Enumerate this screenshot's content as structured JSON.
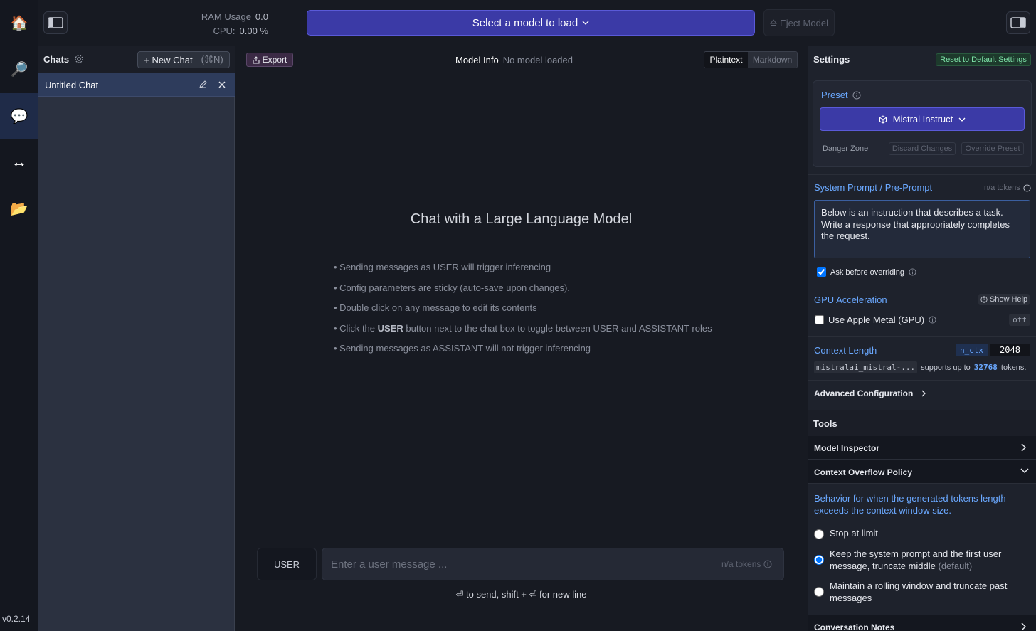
{
  "rail": {
    "items": [
      {
        "name": "home",
        "glyph": "🏠"
      },
      {
        "name": "search",
        "glyph": "🔎"
      },
      {
        "name": "chat",
        "glyph": "💬"
      },
      {
        "name": "server",
        "glyph": "↔"
      },
      {
        "name": "folder",
        "glyph": "📂"
      }
    ],
    "version": "v0.2.14"
  },
  "topbar": {
    "ram_label": "RAM Usage",
    "ram_value": "0.0",
    "cpu_label": "CPU:",
    "cpu_value": "0.00 %",
    "load_model_label": "Select a model to load",
    "eject_label": "Eject Model"
  },
  "chats": {
    "title": "Chats",
    "new_chat_label": "+ New Chat",
    "new_chat_shortcut": "(⌘N)",
    "items": [
      {
        "name": "Untitled Chat"
      }
    ]
  },
  "main": {
    "export_label": "Export",
    "model_info_label": "Model Info",
    "model_info_value": "No model loaded",
    "format_tabs": [
      "Plaintext",
      "Markdown"
    ],
    "hero_title": "Chat with a Large Language Model",
    "tips": [
      {
        "pre": "Sending messages as USER will trigger inferencing",
        "bold": "",
        "post": ""
      },
      {
        "pre": "Config parameters are sticky (auto-save upon changes).",
        "bold": "",
        "post": ""
      },
      {
        "pre": "Double click on any message to edit its contents",
        "bold": "",
        "post": ""
      },
      {
        "pre": "Click the ",
        "bold": "USER",
        "post": " button next to the chat box to toggle between USER and ASSISTANT roles"
      },
      {
        "pre": "Sending messages as ASSISTANT will not trigger inferencing",
        "bold": "",
        "post": ""
      }
    ],
    "role_label": "USER",
    "input_placeholder": "Enter a user message ...",
    "input_tokens": "n/a tokens",
    "send_hint": "⏎ to send, shift + ⏎ for new line"
  },
  "settings": {
    "title": "Settings",
    "reset_label": "Reset to Default Settings",
    "preset_label": "Preset",
    "preset_value": "Mistral Instruct",
    "danger_zone_label": "Danger Zone",
    "discard_label": "Discard Changes",
    "override_label": "Override Preset",
    "system_prompt_label": "System Prompt / Pre-Prompt",
    "system_prompt_tokens": "n/a tokens",
    "system_prompt_text": "Below is an instruction that describes a task. Write a response that appropriately completes the request.",
    "ask_before_overriding": "Ask before overriding",
    "gpu_label": "GPU Acceleration",
    "show_help_label": "Show Help",
    "gpu_checkbox_label": "Use Apple Metal (GPU)",
    "gpu_state": "off",
    "context_length_label": "Context Length",
    "n_ctx_label": "n_ctx",
    "n_ctx_value": "2048",
    "model_name_short": "mistralai_mistral-...",
    "supports_pre": "supports up to",
    "supports_value": "32768",
    "supports_post": "tokens.",
    "advanced_label": "Advanced Configuration",
    "tools_title": "Tools",
    "model_inspector_label": "Model Inspector",
    "context_overflow_label": "Context Overflow Policy",
    "overflow_description": "Behavior for when the generated tokens length exceeds the context window size.",
    "overflow_options": [
      {
        "label": "Stop at limit",
        "suffix": "",
        "selected": false
      },
      {
        "label": "Keep the system prompt and the first user message, truncate middle",
        "suffix": "(default)",
        "selected": true
      },
      {
        "label": "Maintain a rolling window and truncate past messages",
        "suffix": "",
        "selected": false
      }
    ],
    "conversation_notes_label": "Conversation Notes"
  },
  "colors": {
    "accent": "#3b3aa6",
    "link_blue": "#6aa8ff",
    "active_chat": "#2e3c5c",
    "reset_green": "#7ee3a8"
  }
}
